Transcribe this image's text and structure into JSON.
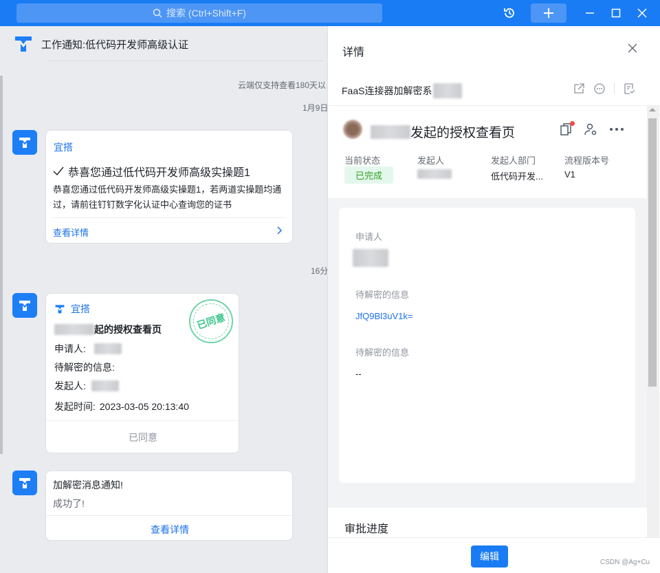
{
  "titlebar": {
    "search_placeholder": "搜索 (Ctrl+Shift+F)",
    "icons": [
      "search-icon",
      "history-icon",
      "plus-icon",
      "minimize-icon",
      "maximize-icon",
      "close-icon"
    ],
    "accent": "#1a7cf4"
  },
  "chat": {
    "title": "工作通知:低代码开发师高级认证",
    "system_note": "云端仅支持查看180天以",
    "time1": "1月9日",
    "time2": "16分",
    "card1": {
      "source": "宜搭",
      "title_icon": "check-icon",
      "title": "恭喜您通过低代码开发师高级实操题1",
      "body": "恭喜您通过低代码开发师高级实操题1，若两道实操题均通过，请前往钉钉数字化认证中心查询您的证书",
      "link": "查看详情"
    },
    "card2": {
      "source": "宜搭",
      "title_suffix": "起的授权查看页",
      "applicant_label": "申请人:",
      "info_label": "待解密的信息:",
      "initiator_label": "发起人:",
      "time_label": "发起时间:",
      "time_value": "2023-03-05 20:13:40",
      "stamp": "已同意",
      "footer": "已同意"
    },
    "card3": {
      "title": "加解密消息通知!",
      "subtitle": "成功了!",
      "link": "查看详情"
    }
  },
  "panel": {
    "title": "详情",
    "flow_name": "FaaS连接器加解密系",
    "summary": {
      "title_suffix": "发起的授权查看页",
      "status_label": "当前状态",
      "status_value": "已完成",
      "initiator_label": "发起人",
      "dept_label": "发起人部门",
      "dept_value": "低代码开发...",
      "version_label": "流程版本号",
      "version_value": "V1",
      "status_color": "#2ea121"
    },
    "detail": {
      "applicant_label": "申请人",
      "info1_label": "待解密的信息",
      "info1_value": "JfQ9Bl3uV1k=",
      "info2_label": "待解密的信息",
      "info2_value": "--"
    },
    "progress_title": "审批进度",
    "edit_button": "编辑",
    "watermark": "CSDN @Ag+Cu"
  }
}
